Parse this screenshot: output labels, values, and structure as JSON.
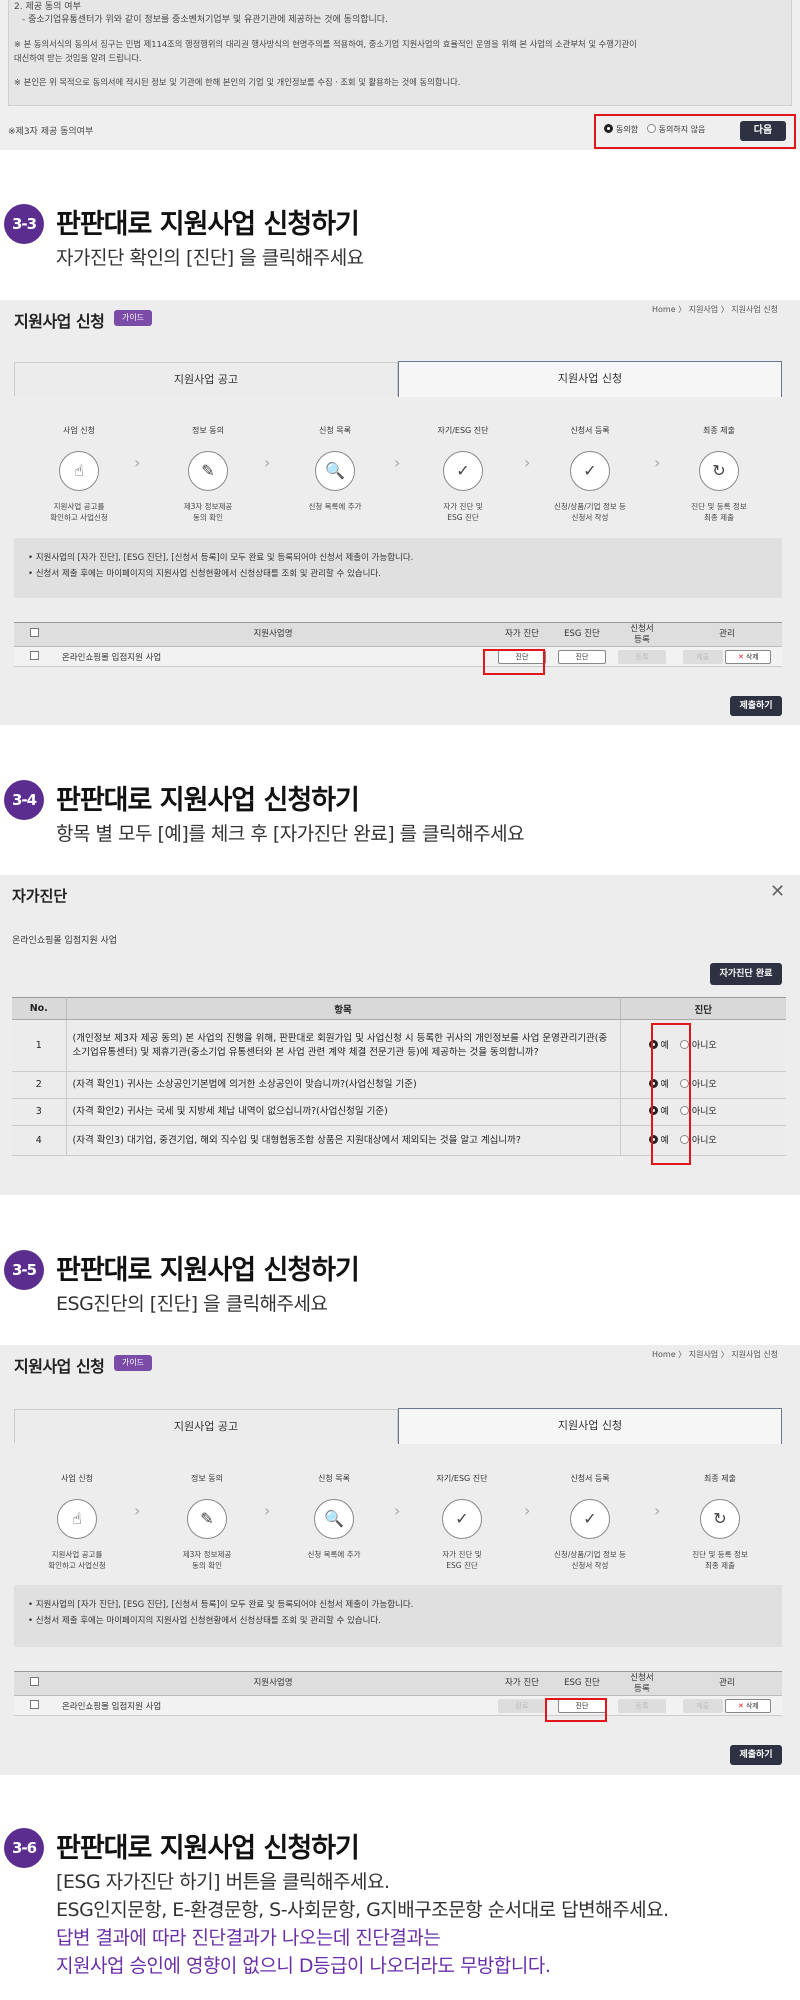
{
  "consent_section": {
    "lines": [
      "2. 제공 동의 여부",
      "- 중소기업유통센터가 위와 같이 정보를 중소벤처기업부 및 유관기관에 제공하는 것에 동의합니다.",
      "※ 본 동의서식의 동의서 징구는 민법 제114조의 행정행위의 대리권 행사방식의 현명주의를 적용하여, 중소기업 지원사업의 효율적인 운영을 위해 본 사업의 소관부처 및 수행기관이",
      "대신하여 받는 것임을 알려 드립니다.",
      "※ 본인은 위 목적으로 동의서에 적시된 정보 및 기관에 한해 본인의 기업 및 개인정보를 수집ㆍ조회 및 활용하는 것에 동의합니다."
    ],
    "third_party_label": "※제3자 제공 동의여부",
    "agree": "동의함",
    "disagree": "동의하지 않음",
    "next_button": "다음"
  },
  "steps": [
    {
      "num": "3-3",
      "title": "판판대로 지원사업 신청하기",
      "desc": [
        "자가진단 확인의 [진단] 을 클릭해주세요"
      ]
    },
    {
      "num": "3-4",
      "title": "판판대로 지원사업 신청하기",
      "desc": [
        "항목 별 모두 [예]를 체크 후 [자가진단 완료] 를 클릭해주세요"
      ]
    },
    {
      "num": "3-5",
      "title": "판판대로 지원사업 신청하기",
      "desc": [
        "ESG진단의 [진단] 을 클릭해주세요"
      ]
    },
    {
      "num": "3-6",
      "title": "판판대로 지원사업 신청하기",
      "desc": [
        "[ESG 자가진단 하기] 버튼을 클릭해주세요.",
        "ESG인지문항, E-환경문항, S-사회문항, G지배구조문항 순서대로 답변해주세요.",
        "답변 결과에 따라 진단결과가 나오는데 진단결과는",
        "지원사업 승인에 영향이 없으니 D등급이 나오더라도 무방합니다."
      ]
    }
  ],
  "app": {
    "title": "지원사업 신청",
    "guide": "가이드",
    "breadcrumb": "Home 〉 지원사업 〉 지원사업 신청",
    "tabs": [
      "지원사업 공고",
      "지원사업 신청"
    ],
    "process": [
      {
        "label": "사업 신청",
        "icon": "☝",
        "desc": "지원사업 공고를\n확인하고 사업신청"
      },
      {
        "label": "정보 동의",
        "icon": "✎",
        "desc": "제3자 정보제공\n동의 확인"
      },
      {
        "label": "신청 목록",
        "icon": "🔍",
        "desc": "신청 목록에 추가"
      },
      {
        "label": "자기/ESG 진단",
        "icon": "✓",
        "desc": "자가 진단 및\nESG 진단"
      },
      {
        "label": "신청서 등록",
        "icon": "✓",
        "desc": "신청/상품/기업 정보 등\n신청서 작성"
      },
      {
        "label": "최종 제출",
        "icon": "↻",
        "desc": "진단 및 등록 정보\n최종 제출"
      }
    ],
    "notices": [
      "• 지원사업의 [자가 진단], [ESG 진단], [신청서 등록]이 모두 완료 및 등록되어야 신청서 제출이 가능합니다.",
      "• 신청서 제출 후에는 마이페이지의 지원사업 신청현황에서 신청상태를 조회 및 관리할 수 있습니다."
    ],
    "table_headers": [
      "지원사업명",
      "자가 진단",
      "ESG 진단",
      "신청서\n등록",
      "관리"
    ],
    "row_name": "온라인쇼핑몰 입점지원 사업",
    "btn_diag": "진단",
    "btn_done": "완료",
    "btn_reg": "등록",
    "btn_submit_small": "제출",
    "btn_delete": "삭제",
    "submit_button": "제출하기"
  },
  "modal": {
    "title": "자가진단",
    "close": "✕",
    "program": "온라인쇼핑몰 입점지원 사업",
    "complete_button": "자가진단 완료",
    "headers": [
      "No.",
      "항목",
      "진단"
    ],
    "yes": "예",
    "no": "아니오",
    "questions": [
      {
        "no": "1",
        "text": "(개인정보 제3자 제공 동의) 본 사업의 진행을 위해, 판판대로 회원가입 및 사업신청 시 등록한 귀사의 개인정보를 사업 운영관리기관(중소기업유통센터) 및 제휴기관(중소기업 유통센터와 본 사업 관련 계약 체결 전문기관 등)에 제공하는 것을 동의합니까?"
      },
      {
        "no": "2",
        "text": "(자격 확인1) 귀사는 소상공인기본법에 의거한 소상공인이 맞습니까?(사업신청일 기준)"
      },
      {
        "no": "3",
        "text": "(자격 확인2) 귀사는 국세 및 지방세 체납 내역이 없으십니까?(사업신청일 기준)"
      },
      {
        "no": "4",
        "text": "(자격 확인3) 대기업, 중견기업, 해외 직수입 및 대형협동조합 상품은 지원대상에서 제외되는 것을 알고 계십니까?"
      }
    ]
  }
}
